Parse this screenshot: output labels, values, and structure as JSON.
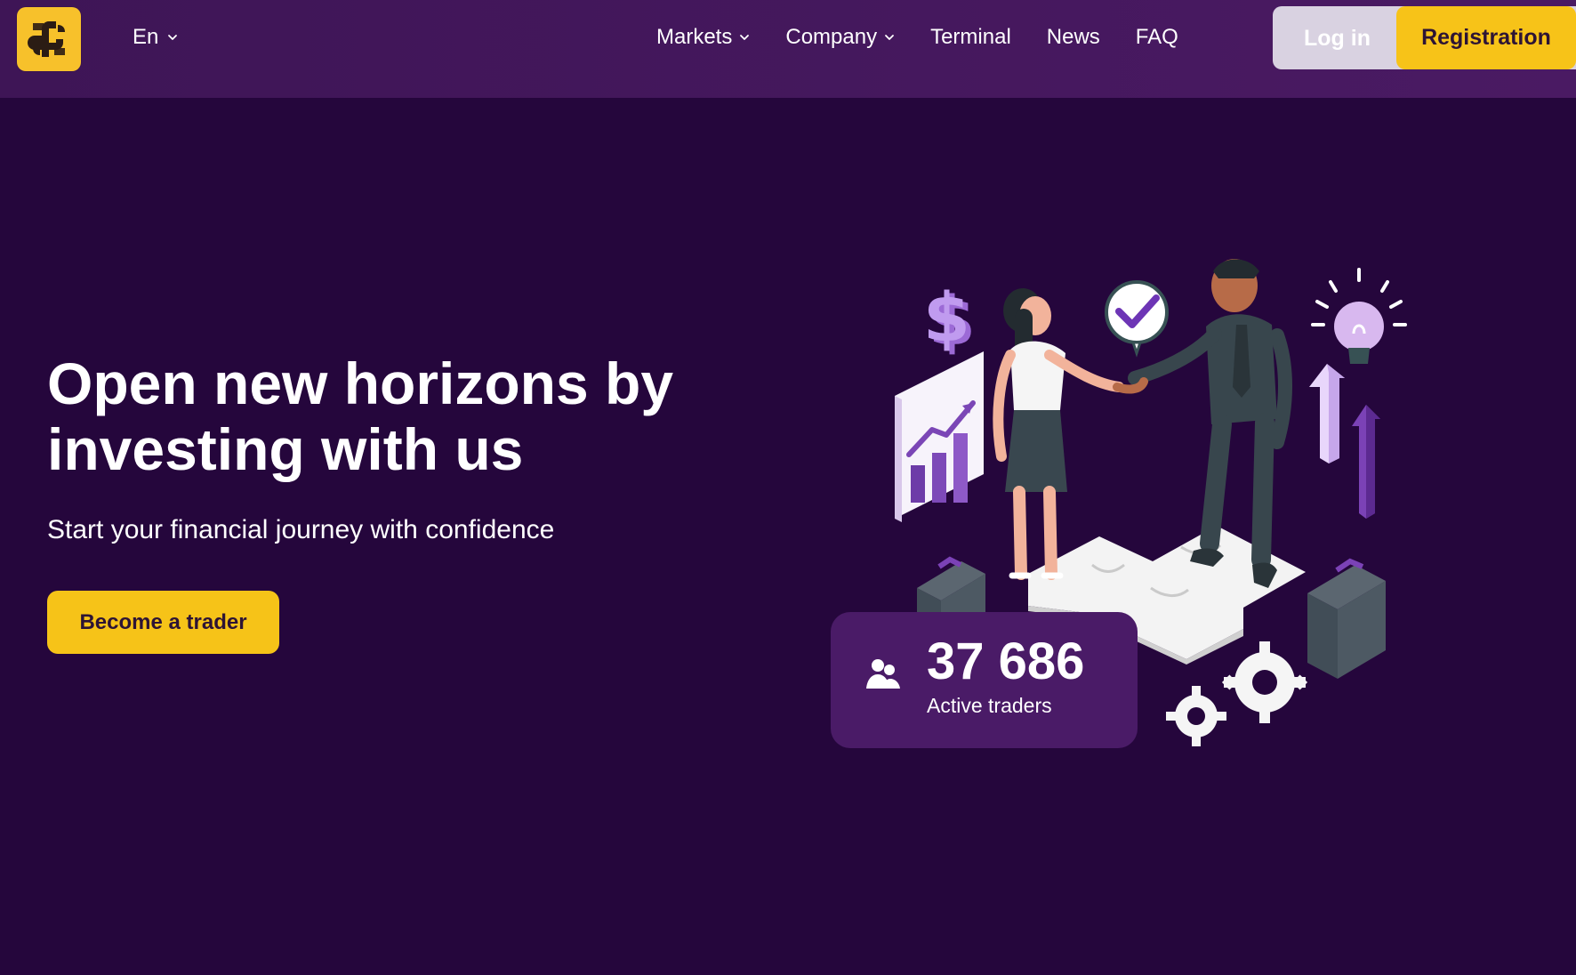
{
  "header": {
    "language": "En",
    "nav": [
      {
        "label": "Markets",
        "dropdown": true
      },
      {
        "label": "Company",
        "dropdown": true
      },
      {
        "label": "Terminal",
        "dropdown": false
      },
      {
        "label": "News",
        "dropdown": false
      },
      {
        "label": "FAQ",
        "dropdown": false
      }
    ],
    "login_label": "Log in",
    "registration_label": "Registration"
  },
  "hero": {
    "title_line_1": "Open new horizons by",
    "title_line_2": "investing with us",
    "subtitle": "Start your financial journey with confidence",
    "cta_label": "Become a trader"
  },
  "stats": {
    "value": "37 686",
    "label": "Active traders"
  },
  "colors": {
    "page_bg": "#25063c",
    "header_bg": "#441760",
    "accent": "#f7c318",
    "card_bg": "#4a1b67"
  },
  "icons": {
    "logo": "brand-logo",
    "language_chevron": "chevron-down-icon",
    "nav_chevron": "chevron-down-icon",
    "traders": "users-icon"
  }
}
